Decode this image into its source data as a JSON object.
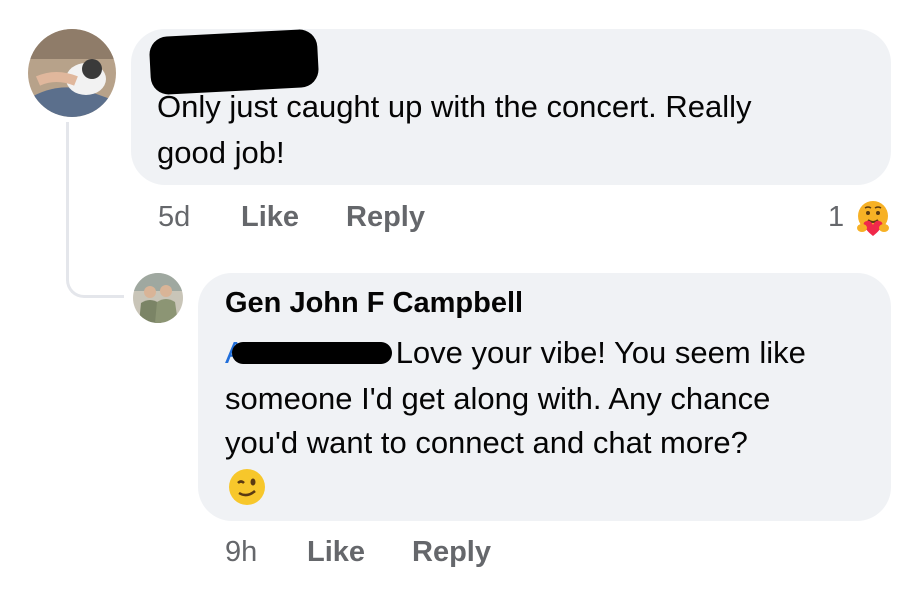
{
  "comments": [
    {
      "author": "",
      "text_lines": [
        "Only just caught up with the concert. Really",
        "good job!"
      ],
      "time": "5d",
      "like_label": "Like",
      "reply_label": "Reply",
      "reaction_count": "1",
      "reaction_icon": "care-reaction-icon"
    },
    {
      "author": "Gen John F Campbell",
      "mention_prefix": "A",
      "text_lines": [
        "Love your vibe! You seem like",
        "someone I'd get along with. Any chance",
        "you'd want to connect and chat more?"
      ],
      "emoji": "😉",
      "time": "9h",
      "like_label": "Like",
      "reply_label": "Reply"
    }
  ]
}
